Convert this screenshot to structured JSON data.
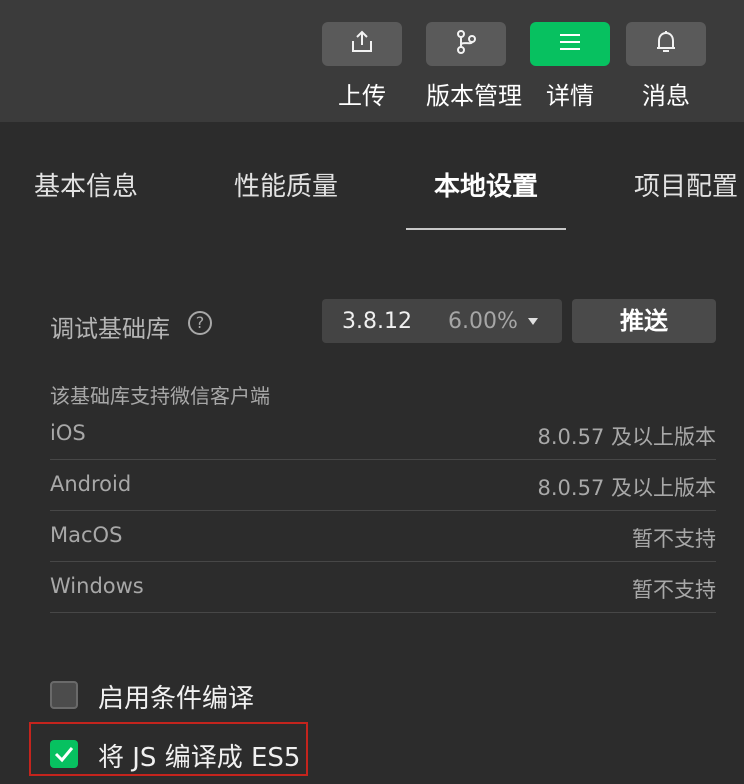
{
  "toolbar": {
    "items": [
      {
        "label": "上传",
        "icon": "upload-icon",
        "active": false
      },
      {
        "label": "版本管理",
        "icon": "branch-icon",
        "active": false
      },
      {
        "label": "详情",
        "icon": "menu-icon",
        "active": true
      },
      {
        "label": "消息",
        "icon": "bell-icon",
        "active": false
      }
    ],
    "accent": "#07c160"
  },
  "tabs": [
    {
      "label": "基本信息"
    },
    {
      "label": "性能质量"
    },
    {
      "label": "本地设置",
      "active": true
    },
    {
      "label": "项目配置"
    }
  ],
  "library": {
    "label": "调试基础库",
    "help": "?",
    "version": "3.8.12",
    "percent": "6.00%",
    "push_label": "推送"
  },
  "support": {
    "title": "该基础库支持微信客户端",
    "clients": [
      {
        "name": "iOS",
        "value": "8.0.57 及以上版本"
      },
      {
        "name": "Android",
        "value": "8.0.57 及以上版本"
      },
      {
        "name": "MacOS",
        "value": "暂不支持"
      },
      {
        "name": "Windows",
        "value": "暂不支持"
      }
    ]
  },
  "options": [
    {
      "label": "启用条件编译",
      "checked": false
    },
    {
      "label": "将 JS 编译成 ES5",
      "checked": true
    }
  ],
  "colors": {
    "highlight": "#c4241d"
  }
}
